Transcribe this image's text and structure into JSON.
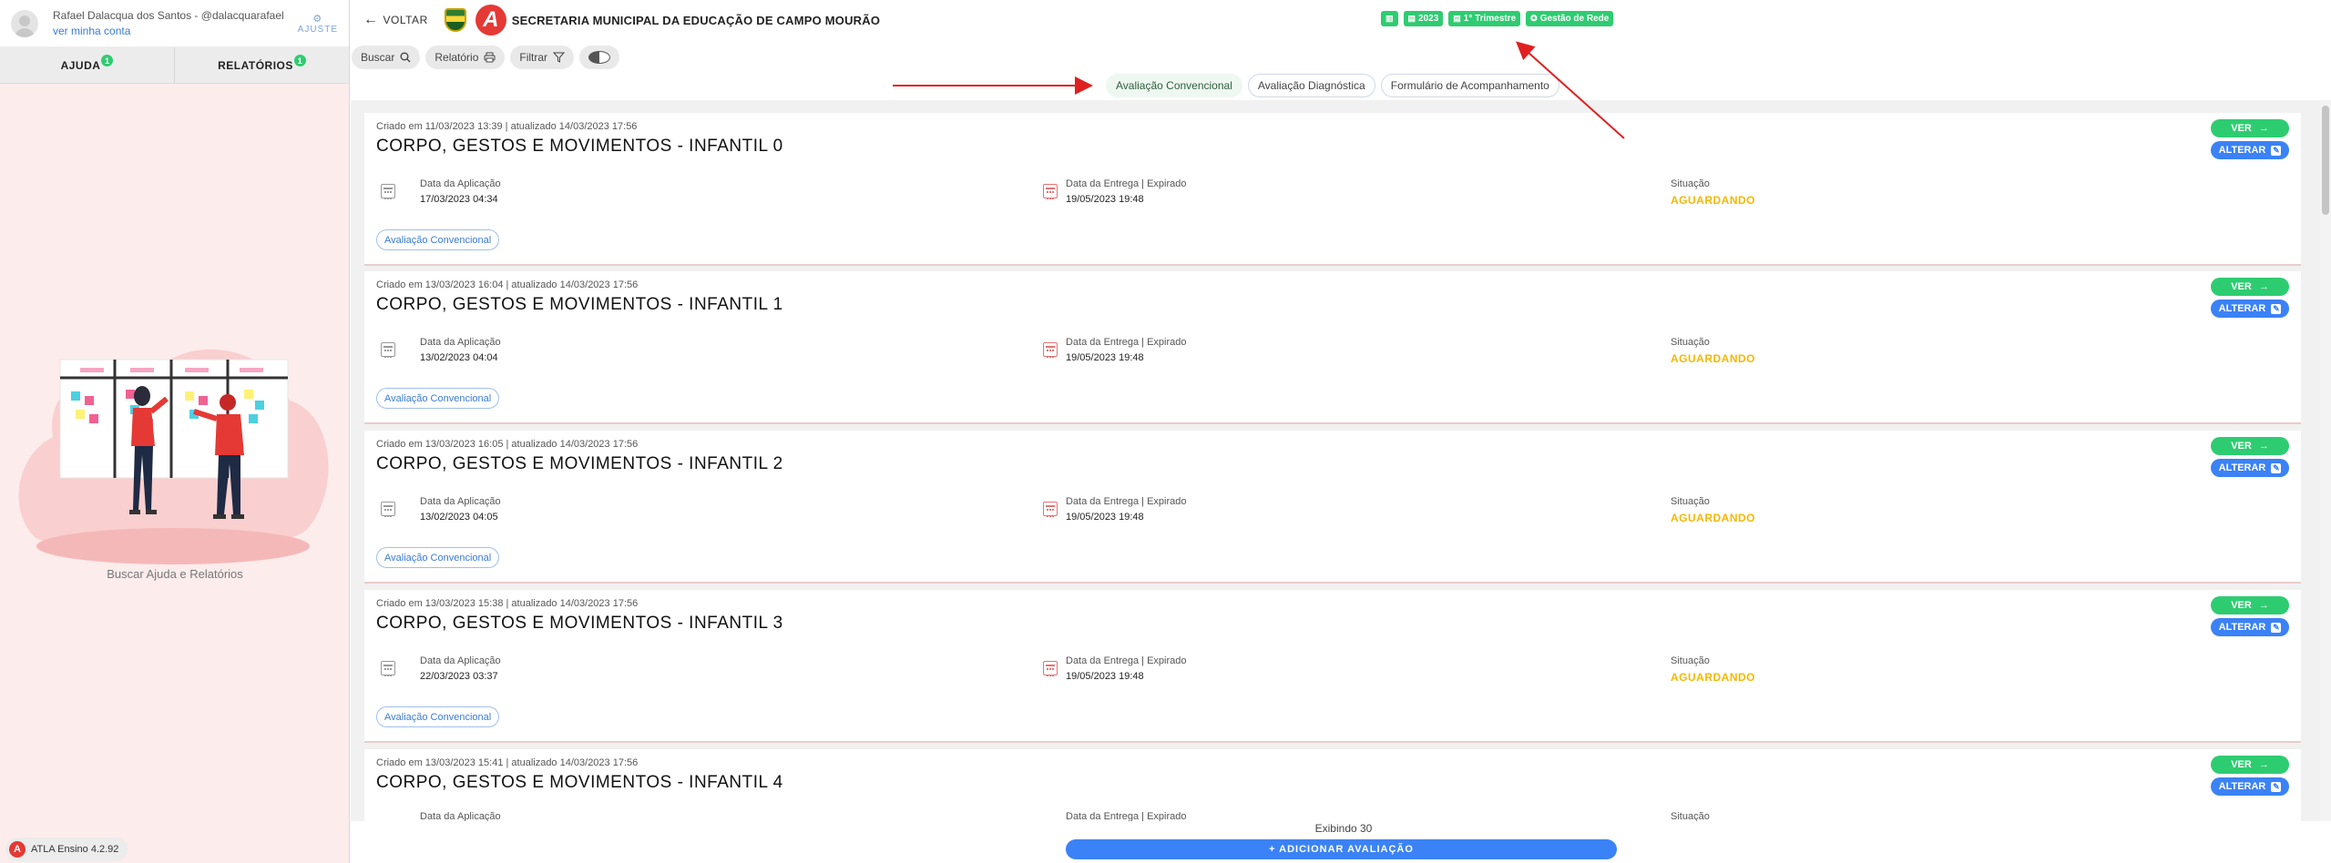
{
  "user": {
    "name": "Rafael Dalacqua dos Santos - @dalacquarafael",
    "link": "ver minha conta",
    "settings_label": "AJUSTE"
  },
  "sidebar": {
    "tabs": [
      {
        "label": "AJUDA",
        "badge": "1"
      },
      {
        "label": "RELATÓRIOS",
        "badge": "1"
      }
    ],
    "caption": "Buscar Ajuda e Relatórios",
    "version": "ATLA Ensino 4.2.92",
    "logo_letter": "A"
  },
  "header": {
    "back_label": "VOLTAR",
    "logo_letter": "A",
    "org_title": "SECRETARIA MUNICIPAL DA EDUCAÇÃO DE CAMPO MOURÃO",
    "badges": [
      {
        "icon": "chart-icon",
        "label": ""
      },
      {
        "icon": "calendar-icon",
        "label": "2023"
      },
      {
        "icon": "calendar-icon",
        "label": "1° Trimestre"
      },
      {
        "icon": "cog-icon",
        "label": "Gestão de Rede"
      }
    ]
  },
  "toolbar": {
    "search_label": "Buscar",
    "report_label": "Relatório",
    "filter_label": "Filtrar"
  },
  "type_tabs": [
    {
      "label": "Avaliação Convencional",
      "active": true
    },
    {
      "label": "Avaliação Diagnóstica",
      "active": false
    },
    {
      "label": "Formulário de Acompanhamento",
      "active": false
    }
  ],
  "cards": [
    {
      "meta": "Criado em 11/03/2023 13:39 | atualizado 14/03/2023 17:56",
      "title": "CORPO, GESTOS E MOVIMENTOS - INFANTIL 0",
      "application_label": "Data da Aplicação",
      "application_date": "17/03/2023 04:34",
      "delivery_label": "Data da Entrega | Expirado",
      "delivery_date": "19/05/2023 19:48",
      "status_label": "Situação",
      "status": "AGUARDANDO",
      "tag": "Avaliação Convencional",
      "view_label": "VER",
      "edit_label": "ALTERAR"
    },
    {
      "meta": "Criado em 13/03/2023 16:04 | atualizado 14/03/2023 17:56",
      "title": "CORPO, GESTOS E MOVIMENTOS - INFANTIL 1",
      "application_label": "Data da Aplicação",
      "application_date": "13/02/2023 04:04",
      "delivery_label": "Data da Entrega | Expirado",
      "delivery_date": "19/05/2023 19:48",
      "status_label": "Situação",
      "status": "AGUARDANDO",
      "tag": "Avaliação Convencional",
      "view_label": "VER",
      "edit_label": "ALTERAR"
    },
    {
      "meta": "Criado em 13/03/2023 16:05 | atualizado 14/03/2023 17:56",
      "title": "CORPO, GESTOS E MOVIMENTOS - INFANTIL 2",
      "application_label": "Data da Aplicação",
      "application_date": "13/02/2023 04:05",
      "delivery_label": "Data da Entrega | Expirado",
      "delivery_date": "19/05/2023 19:48",
      "status_label": "Situação",
      "status": "AGUARDANDO",
      "tag": "Avaliação Convencional",
      "view_label": "VER",
      "edit_label": "ALTERAR"
    },
    {
      "meta": "Criado em 13/03/2023 15:38 | atualizado 14/03/2023 17:56",
      "title": "CORPO, GESTOS E MOVIMENTOS - INFANTIL 3",
      "application_label": "Data da Aplicação",
      "application_date": "22/03/2023 03:37",
      "delivery_label": "Data da Entrega | Expirado",
      "delivery_date": "19/05/2023 19:48",
      "status_label": "Situação",
      "status": "AGUARDANDO",
      "tag": "Avaliação Convencional",
      "view_label": "VER",
      "edit_label": "ALTERAR"
    },
    {
      "meta": "Criado em 13/03/2023 15:41 | atualizado 14/03/2023 17:56",
      "title": "CORPO, GESTOS E MOVIMENTOS - INFANTIL 4",
      "application_label": "Data da Aplicação",
      "application_date": "",
      "delivery_label": "Data da Entrega | Expirado",
      "delivery_date": "",
      "status_label": "Situação",
      "status": "",
      "tag": "",
      "view_label": "VER",
      "edit_label": "ALTERAR"
    }
  ],
  "footer": {
    "count_text": "Exibindo 30",
    "add_label": "+ ADICIONAR AVALIAÇÃO"
  },
  "colors": {
    "green": "#2ecc71",
    "blue": "#3b82f6",
    "status_yellow": "#f5b800",
    "brand_red": "#e53935",
    "annotation_red": "#e02020"
  }
}
